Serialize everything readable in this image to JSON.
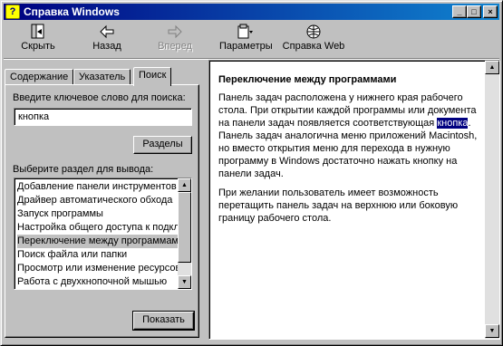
{
  "window": {
    "title": "Справка Windows",
    "icons": {
      "app": "help-book-icon",
      "minimize": "minimize-icon",
      "maximize": "maximize-icon",
      "close": "close-icon"
    }
  },
  "toolbar": {
    "hide": {
      "label": "Скрыть",
      "icon": "hide-icon"
    },
    "back": {
      "label": "Назад",
      "icon": "arrow-left-icon"
    },
    "forward": {
      "label": "Вперед",
      "icon": "arrow-right-icon"
    },
    "options": {
      "label": "Параметры",
      "icon": "options-icon"
    },
    "web_help": {
      "label": "Справка Web",
      "icon": "web-help-icon"
    }
  },
  "tabs": [
    {
      "label": "Содержание"
    },
    {
      "label": "Указатель"
    },
    {
      "label": "Поиск"
    }
  ],
  "search": {
    "keyword_label": "Введите ключевое слово для поиска:",
    "keyword_value": "кнопка",
    "topics_button": "Разделы",
    "select_label": "Выберите раздел для вывода:",
    "results": [
      "Добавление панели инструментов",
      "Драйвер автоматического обхода",
      "Запуск программы",
      "Настройка общего доступа к подкл",
      "Переключение между программами",
      "Поиск файла или папки",
      "Просмотр или изменение ресурсов",
      "Работа с двухкнопочной мышью"
    ],
    "selected_index": 4,
    "display_button": "Показать"
  },
  "topic": {
    "heading": "Переключение между программами",
    "para1_before": "Панель задач расположена у нижнего края рабочего стола. При открытии каждой программы или документа на панели задач появляется соответствующая ",
    "para1_highlight": "кнопка",
    "para1_after": ". Панель задач аналогична меню приложений Macintosh, но вместо открытия меню для перехода в нужную программу в Windows достаточно нажать кнопку на панели задач.",
    "para2": "При желании пользователь имеет возможность перетащить панель задач на верхнюю или боковую границу рабочего стола."
  }
}
